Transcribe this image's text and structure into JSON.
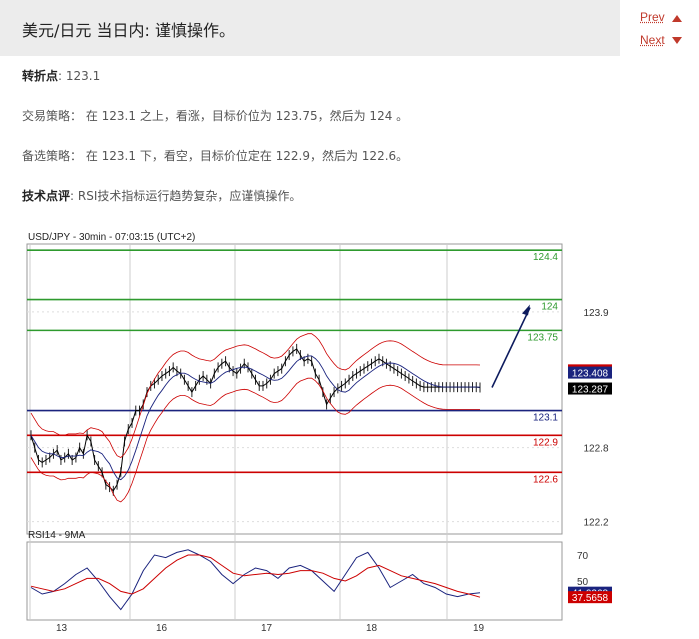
{
  "header": {
    "title": "美元/日元 当日内: 谨慎操作。",
    "prev_label": "Prev",
    "next_label": "Next"
  },
  "body": {
    "pivot_label": "转折点",
    "pivot_value": ": 123.1",
    "strategy_label": "交易策略",
    "strategy_text": "：  在 123.1 之上，看涨，目标价位为 123.75，然后为 124 。",
    "alt_label": "备选策略",
    "alt_text": "：  在 123.1 下，看空，目标价位定在 122.9，然后为 122.6。",
    "comment_label": "技术点评",
    "comment_text": ": RSI技术指标运行趋势复杂，应谨慎操作。"
  },
  "colors": {
    "support": "#cc0000",
    "resistance": "#2e9a2e",
    "pivot": "#1a237e",
    "price": "#000000",
    "bollinger": "#cc0000",
    "ma": "#1a237e"
  },
  "chart_data": [
    {
      "type": "line",
      "title": "USD/JPY - 30min - 07:03:15 (UTC+2)",
      "x_tick_labels": [
        "13",
        "16",
        "17",
        "18",
        "19"
      ],
      "y_tick_labels": [
        "123.9",
        "122.8",
        "122.2"
      ],
      "ylim": [
        122.1,
        124.45
      ],
      "grid": true,
      "levels": [
        {
          "name": "124.4",
          "value": 124.4,
          "kind": "resistance"
        },
        {
          "name": "124",
          "value": 124.0,
          "kind": "resistance"
        },
        {
          "name": "123.75",
          "value": 123.75,
          "kind": "resistance"
        },
        {
          "name": "123.1",
          "value": 123.1,
          "kind": "pivot"
        },
        {
          "name": "122.9",
          "value": 122.9,
          "kind": "support"
        },
        {
          "name": "122.6",
          "value": 122.6,
          "kind": "support"
        }
      ],
      "price_boxes": [
        {
          "label": "123.418",
          "value": 123.418,
          "color": "#cc0000"
        },
        {
          "label": "123.408",
          "value": 123.408,
          "color": "#1a237e"
        },
        {
          "label": "123.287",
          "value": 123.287,
          "color": "#000000"
        }
      ],
      "series": [
        {
          "kind": "price",
          "x": [
            0,
            2,
            4,
            6,
            8,
            10,
            12,
            14,
            16,
            18,
            20,
            22,
            24,
            26,
            28,
            30,
            32,
            34,
            36,
            38,
            40,
            42,
            44,
            46,
            48,
            50,
            52,
            54,
            56,
            58,
            60,
            62,
            64,
            66,
            68,
            70,
            72,
            74,
            76,
            78,
            80,
            82,
            84,
            86,
            88,
            90,
            92,
            94,
            96,
            98,
            100,
            102,
            104,
            106,
            108,
            110,
            112,
            114,
            116,
            118,
            120,
            122,
            124,
            126,
            128,
            130,
            132,
            134,
            136,
            138,
            140,
            142,
            144,
            146,
            148,
            150,
            152,
            154,
            156,
            158,
            160,
            162,
            164,
            166,
            168,
            170,
            172,
            174,
            176,
            178,
            180,
            182,
            184,
            186,
            188,
            190,
            192,
            194,
            196,
            198,
            200,
            202,
            204,
            206,
            208,
            210,
            212,
            214,
            216,
            218,
            220,
            222,
            224,
            226,
            228,
            230,
            232,
            234,
            236,
            238,
            240
          ],
          "y": [
            122.9,
            122.8,
            122.7,
            122.68,
            122.7,
            122.72,
            122.75,
            122.78,
            122.7,
            122.72,
            122.75,
            122.7,
            122.72,
            122.8,
            122.75,
            122.9,
            122.85,
            122.7,
            122.65,
            122.6,
            122.5,
            122.48,
            122.45,
            122.5,
            122.6,
            122.85,
            122.95,
            123.0,
            123.1,
            123.1,
            123.15,
            123.25,
            123.3,
            123.32,
            123.35,
            123.38,
            123.4,
            123.42,
            123.45,
            123.42,
            123.4,
            123.35,
            123.3,
            123.25,
            123.3,
            123.35,
            123.38,
            123.35,
            123.32,
            123.4,
            123.45,
            123.48,
            123.5,
            123.45,
            123.42,
            123.4,
            123.44,
            123.48,
            123.45,
            123.4,
            123.35,
            123.3,
            123.3,
            123.32,
            123.35,
            123.4,
            123.42,
            123.44,
            123.5,
            123.55,
            123.58,
            123.6,
            123.55,
            123.5,
            123.52,
            123.5,
            123.4,
            123.35,
            123.25,
            123.15,
            123.2,
            123.25,
            123.28,
            123.3,
            123.32,
            123.35,
            123.38,
            123.4,
            123.42,
            123.44,
            123.46,
            123.48,
            123.5,
            123.52,
            123.5,
            123.48,
            123.46,
            123.44,
            123.42,
            123.4,
            123.38,
            123.36,
            123.34,
            123.32,
            123.3,
            123.29,
            123.29,
            123.29,
            123.29,
            123.29,
            123.29,
            123.29,
            123.29,
            123.29,
            123.29,
            123.29,
            123.29,
            123.29,
            123.29,
            123.29,
            123.287
          ]
        }
      ],
      "forecast_arrow": {
        "from": 123.287,
        "to": 124.0
      }
    },
    {
      "type": "line",
      "title": "RSI14 - 9MA",
      "y_tick_labels": [
        "70",
        "50"
      ],
      "ylim": [
        20,
        80
      ],
      "value_boxes": [
        {
          "label": "41.0268",
          "value": 41.0268,
          "color": "#1a237e"
        },
        {
          "label": "37.5658",
          "value": 37.5658,
          "color": "#cc0000"
        }
      ],
      "series": [
        {
          "kind": "rsi",
          "x": [
            0,
            6,
            12,
            18,
            24,
            30,
            36,
            42,
            48,
            54,
            60,
            66,
            72,
            78,
            84,
            90,
            96,
            102,
            108,
            114,
            120,
            126,
            132,
            138,
            144,
            150,
            156,
            162,
            168,
            174,
            180,
            186,
            192,
            198,
            204,
            210,
            216,
            222,
            228,
            234,
            240
          ],
          "y": [
            45,
            40,
            42,
            48,
            55,
            60,
            50,
            38,
            28,
            40,
            58,
            70,
            68,
            72,
            74,
            70,
            65,
            55,
            48,
            55,
            60,
            58,
            52,
            60,
            62,
            58,
            50,
            42,
            55,
            68,
            72,
            60,
            45,
            50,
            55,
            48,
            45,
            40,
            38,
            40,
            41.0268
          ]
        },
        {
          "kind": "rsi-ma",
          "x": [
            0,
            6,
            12,
            18,
            24,
            30,
            36,
            42,
            48,
            54,
            60,
            66,
            72,
            78,
            84,
            90,
            96,
            102,
            108,
            114,
            120,
            126,
            132,
            138,
            144,
            150,
            156,
            162,
            168,
            174,
            180,
            186,
            192,
            198,
            204,
            210,
            216,
            222,
            228,
            234,
            240
          ],
          "y": [
            46,
            44,
            42,
            44,
            48,
            52,
            52,
            48,
            42,
            40,
            44,
            52,
            60,
            66,
            70,
            70,
            68,
            62,
            56,
            54,
            55,
            56,
            55,
            56,
            58,
            58,
            56,
            52,
            50,
            54,
            60,
            62,
            58,
            54,
            52,
            50,
            48,
            45,
            42,
            40,
            37.5658
          ]
        }
      ]
    }
  ]
}
